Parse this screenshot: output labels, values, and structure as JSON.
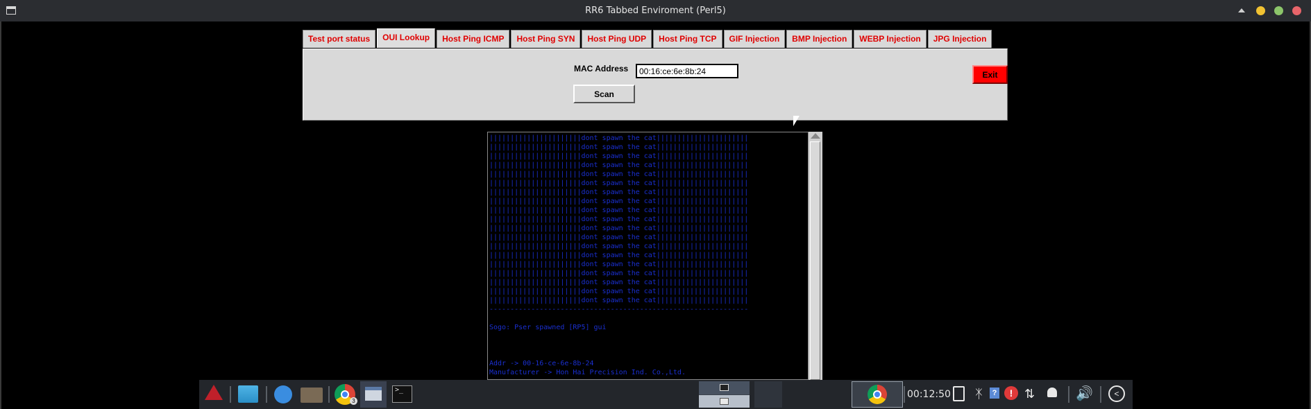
{
  "window": {
    "title": "RR6 Tabbed Enviroment (Perl5)",
    "icons": [
      "app-icon",
      "keep-above-icon",
      "minimize-icon",
      "maximize-icon",
      "close-icon"
    ]
  },
  "tabs": [
    {
      "label": "Test port status",
      "active": false
    },
    {
      "label": "OUI Lookup",
      "active": true
    },
    {
      "label": "Host Ping ICMP",
      "active": false
    },
    {
      "label": "Host Ping SYN",
      "active": false
    },
    {
      "label": "Host Ping UDP",
      "active": false
    },
    {
      "label": "Host Ping TCP",
      "active": false
    },
    {
      "label": "GIF Injection",
      "active": false
    },
    {
      "label": "BMP Injection",
      "active": false
    },
    {
      "label": "WEBP Injection",
      "active": false
    },
    {
      "label": "JPG Injection",
      "active": false
    }
  ],
  "form": {
    "mac_label": "MAC Address",
    "mac_value": "00:16:ce:6e:8b:24",
    "scan_label": "Scan",
    "exit_label": "Exit"
  },
  "output": {
    "lines": [
      "||||||||||||||||||||||dont spawn the cat||||||||||||||||||||||",
      "||||||||||||||||||||||dont spawn the cat||||||||||||||||||||||",
      "||||||||||||||||||||||dont spawn the cat||||||||||||||||||||||",
      "||||||||||||||||||||||dont spawn the cat||||||||||||||||||||||",
      "||||||||||||||||||||||dont spawn the cat||||||||||||||||||||||",
      "||||||||||||||||||||||dont spawn the cat||||||||||||||||||||||",
      "||||||||||||||||||||||dont spawn the cat||||||||||||||||||||||",
      "||||||||||||||||||||||dont spawn the cat||||||||||||||||||||||",
      "||||||||||||||||||||||dont spawn the cat||||||||||||||||||||||",
      "||||||||||||||||||||||dont spawn the cat||||||||||||||||||||||",
      "||||||||||||||||||||||dont spawn the cat||||||||||||||||||||||",
      "||||||||||||||||||||||dont spawn the cat||||||||||||||||||||||",
      "||||||||||||||||||||||dont spawn the cat||||||||||||||||||||||",
      "||||||||||||||||||||||dont spawn the cat||||||||||||||||||||||",
      "||||||||||||||||||||||dont spawn the cat||||||||||||||||||||||",
      "||||||||||||||||||||||dont spawn the cat||||||||||||||||||||||",
      "||||||||||||||||||||||dont spawn the cat||||||||||||||||||||||",
      "||||||||||||||||||||||dont spawn the cat||||||||||||||||||||||",
      "||||||||||||||||||||||dont spawn the cat||||||||||||||||||||||",
      "--------------------------------------------------------------",
      "",
      "Sogo: Pser spawned [RP5] gui",
      "",
      "",
      "",
      "Addr -> 00-16-ce-6e-8b-24",
      "Manufacturer -> Hon Hai Precision Ind. Co.,Ltd."
    ]
  },
  "taskbar": {
    "chrome_badge": "3",
    "terminal_glyph": ">_",
    "clock": "00:12:50",
    "icons": [
      "app-menu-icon",
      "show-desktop-icon",
      "browser-compass-icon",
      "file-manager-icon",
      "chrome-icon",
      "window-icon",
      "terminal-icon",
      "workspace-pager",
      "chrome-window-icon",
      "clipboard-icon",
      "bluetooth-icon",
      "help-icon",
      "alert-icon",
      "network-icon",
      "notifications-bell-icon",
      "volume-icon",
      "back-arrow-icon"
    ]
  },
  "colors": {
    "tab_text": "#e00000",
    "exit_button": "#ff0000",
    "output_text": "#1a2fd0",
    "panel_bg": "#d9d9d9"
  }
}
